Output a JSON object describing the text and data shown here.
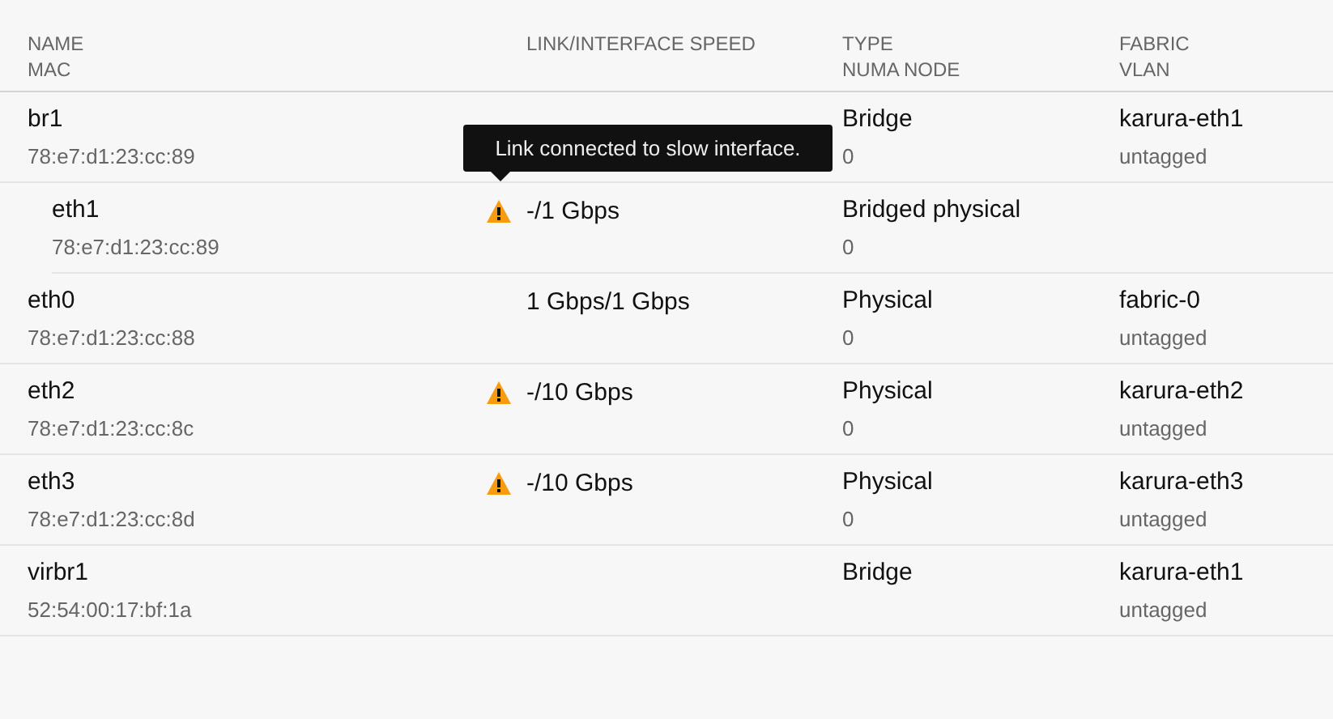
{
  "columns": [
    {
      "primary": "NAME",
      "secondary": "MAC"
    },
    {
      "primary": "LINK/INTERFACE SPEED"
    },
    {
      "primary": "TYPE",
      "secondary": "NUMA NODE"
    },
    {
      "primary": "FABRIC",
      "secondary": "VLAN"
    }
  ],
  "rows": [
    {
      "name": "br1",
      "mac": "78:e7:d1:23:cc:89",
      "warning": false,
      "type": "Bridge",
      "numa_node": "0",
      "fabric": "karura-eth1",
      "vlan": "untagged",
      "children": [
        {
          "name": "eth1",
          "mac": "78:e7:d1:23:cc:89",
          "warning": true,
          "link_speed": "-/1 Gbps",
          "type": "Bridged physical",
          "numa_node": "0"
        }
      ]
    },
    {
      "name": "eth0",
      "mac": "78:e7:d1:23:cc:88",
      "warning": false,
      "link_speed": "1 Gbps/1 Gbps",
      "type": "Physical",
      "numa_node": "0",
      "fabric": "fabric-0",
      "vlan": "untagged"
    },
    {
      "name": "eth2",
      "mac": "78:e7:d1:23:cc:8c",
      "warning": true,
      "link_speed": "-/10 Gbps",
      "type": "Physical",
      "numa_node": "0",
      "fabric": "karura-eth2",
      "vlan": "untagged"
    },
    {
      "name": "eth3",
      "mac": "78:e7:d1:23:cc:8d",
      "warning": true,
      "link_speed": "-/10 Gbps",
      "type": "Physical",
      "numa_node": "0",
      "fabric": "karura-eth3",
      "vlan": "untagged"
    },
    {
      "name": "virbr1",
      "mac": "52:54:00:17:bf:1a",
      "warning": false,
      "type": "Bridge",
      "fabric": "karura-eth1",
      "vlan": "untagged"
    }
  ],
  "tooltip": {
    "text": "Link connected to slow interface."
  }
}
